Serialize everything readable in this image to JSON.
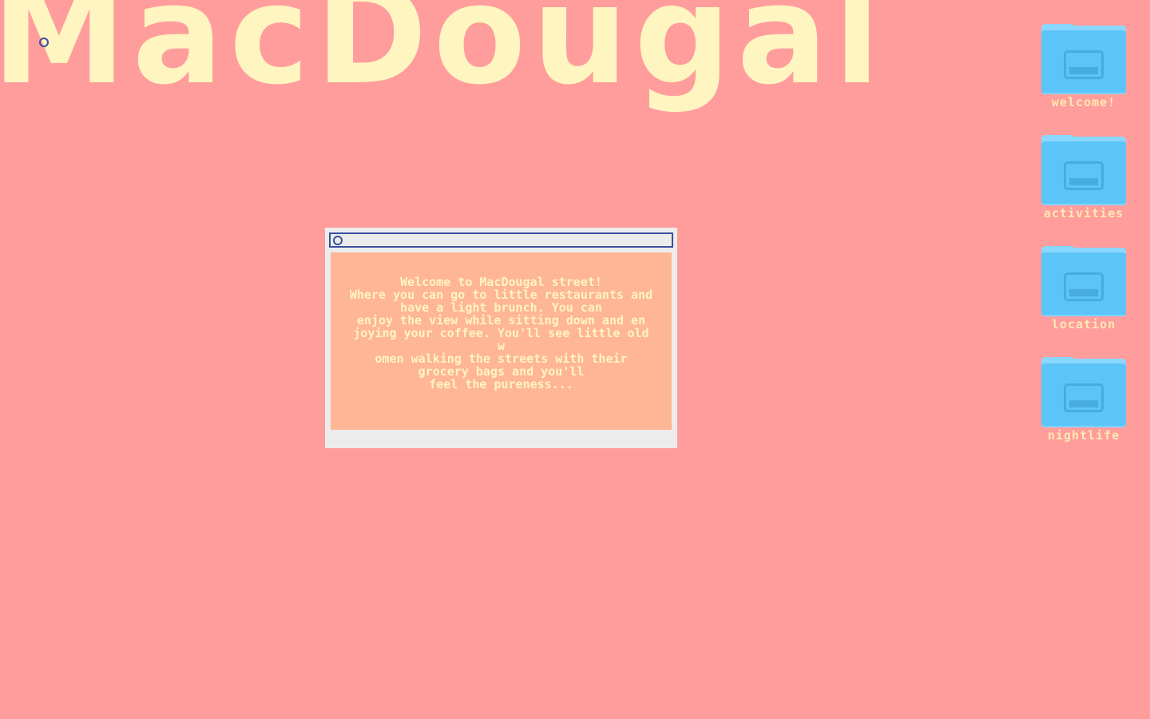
{
  "site": {
    "title": "MacDougal"
  },
  "desktop": {
    "folders": [
      {
        "label": "welcome!",
        "icon": "folder-icon"
      },
      {
        "label": "activities",
        "icon": "folder-icon"
      },
      {
        "label": "location",
        "icon": "folder-icon"
      },
      {
        "label": "nightlife",
        "icon": "folder-icon"
      }
    ]
  },
  "window": {
    "close_icon": "circle-close-icon",
    "text": "Welcome to MacDougal street!\nWhere you can go to little restaurants and\nhave a light brunch. You can\nenjoy the view while sitting down and en\njoying your coffee. You'll see little old w\nomen walking the streets with their\ngrocery bags and you'll\nfeel the pureness..."
  },
  "colors": {
    "background": "#ff9d9d",
    "title": "#fff5c0",
    "folder": "#5bc4f8",
    "window_content": "#ffb695",
    "window_frame": "#ececec",
    "accent": "#3b4f9e"
  }
}
